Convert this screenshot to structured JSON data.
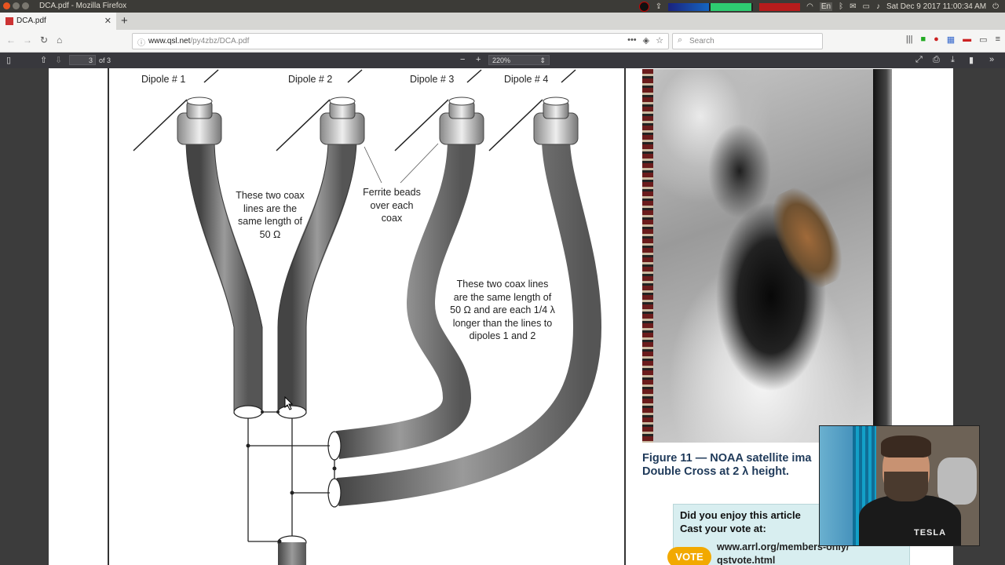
{
  "os": {
    "window_title": "DCA.pdf - Mozilla Firefox",
    "clock": "Sat Dec  9 2017 11:00:34 AM",
    "keyboard_layout": "En"
  },
  "browser": {
    "tab_title": "DCA.pdf",
    "url_host": "www.qsl.net",
    "url_path": "/py4zbz/DCA.pdf",
    "search_placeholder": "Search",
    "icons": [
      "back-icon",
      "forward-icon",
      "reload-icon",
      "home-icon",
      "page-actions-icon",
      "pocket-icon",
      "bookmark-star-icon",
      "library-icon",
      "menu-icon"
    ]
  },
  "pdf_viewer": {
    "page_number": "3",
    "page_count_label": "of 3",
    "zoom_label": "220%",
    "icons": [
      "sidebar-toggle-icon",
      "previous-page-icon",
      "next-page-icon",
      "zoom-out-icon",
      "zoom-in-icon",
      "presentation-icon",
      "print-icon",
      "download-icon",
      "bookmark-icon",
      "tools-icon"
    ]
  },
  "document": {
    "dipoles": [
      "Dipole # 1",
      "Dipole # 2",
      "Dipole # 3",
      "Dipole # 4"
    ],
    "note_same_length": [
      "These two coax",
      "lines are the",
      "same length of",
      "50 Ω"
    ],
    "note_ferrite": [
      "Ferrite beads",
      "over each",
      "coax"
    ],
    "note_quarter_wave": [
      "These two coax lines",
      "are the same length of",
      "50 Ω and are each 1/4 λ",
      "longer than the lines to",
      "dipoles 1 and 2"
    ],
    "figure_caption": [
      "Figure 11 — NOAA satellite ima",
      "Double Cross at 2 λ height."
    ],
    "vote_box": {
      "title_line1": "Did you enjoy this article",
      "title_line2": "Cast your vote at:",
      "url_line1": "www.arrl.org/members-only/",
      "url_line2": "qstvote.html",
      "badge": "VOTE"
    }
  },
  "webcam": {
    "shirt_text": "TESLA"
  },
  "colors": {
    "os_bar": "#3c3b37",
    "pdf_toolbar": "#38383d",
    "caption": "#1f3a5a",
    "vote_box": "#d8eef0",
    "vote_badge": "#f2a900"
  }
}
